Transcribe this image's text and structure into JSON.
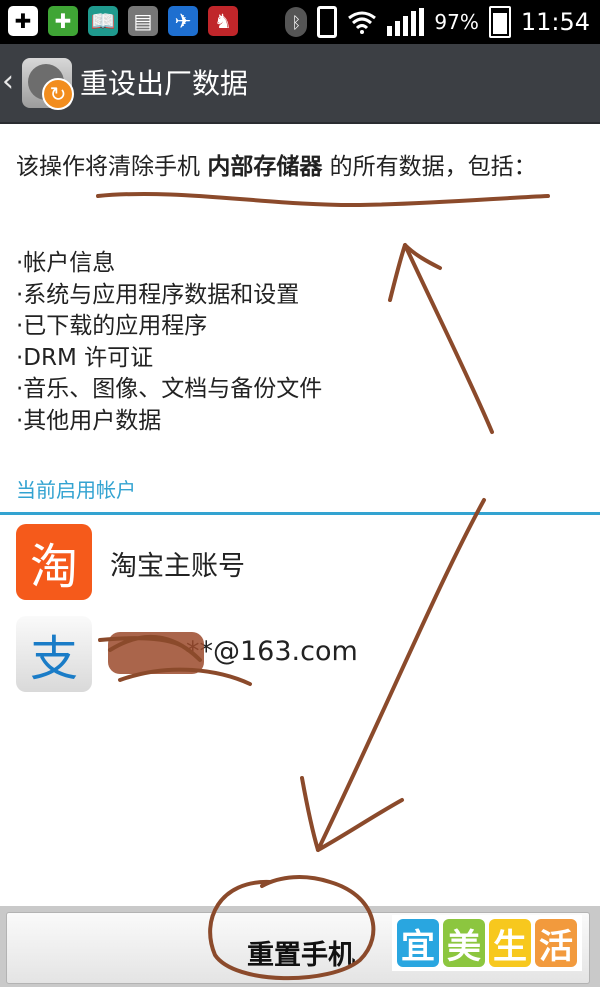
{
  "status_bar": {
    "apps": [
      {
        "icon": "add-box-icon",
        "color": "#000000"
      },
      {
        "icon": "game-plus-icon",
        "color": "#3fa535"
      },
      {
        "icon": "book-app-icon",
        "color": "#1f9a8e"
      },
      {
        "icon": "ftp-server-icon",
        "color": "#777777"
      },
      {
        "icon": "bird-app-icon",
        "color": "#1e6fd0"
      },
      {
        "icon": "cow-app-icon",
        "color": "#c0262a"
      }
    ],
    "battery_level": 0.97,
    "battery_percent": "97%",
    "time": "11:54"
  },
  "action_bar": {
    "title": "重设出厂数据"
  },
  "intro": {
    "prefix": "该操作将清除手机 ",
    "bold": "内部存储器",
    "suffix": " 的所有数据，包括："
  },
  "bullets": [
    "·帐户信息",
    "·系统与应用程序数据和设置",
    "·已下载的应用程序",
    "·DRM 许可证",
    "·音乐、图像、文档与备份文件",
    "·其他用户数据"
  ],
  "accounts_header": "当前启用帐户",
  "accounts": [
    {
      "icon": "taobao-icon",
      "glyph": "淘",
      "label": "淘宝主账号"
    },
    {
      "icon": "alipay-icon",
      "glyph": "支",
      "label": "**@163.com"
    }
  ],
  "reset_button": "重置手机",
  "watermark": [
    "宜",
    "美",
    "生",
    "活"
  ],
  "colors": {
    "accent": "#33a3d1",
    "annotation": "#8b4a2b"
  }
}
